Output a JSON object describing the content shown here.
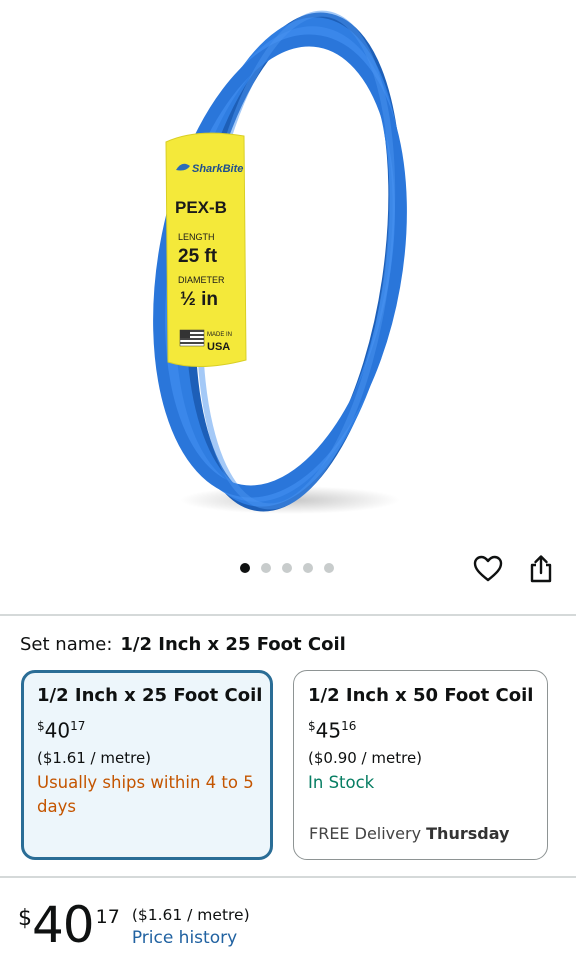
{
  "product_image": {
    "brand": "SharkBite",
    "product_line": "PEX-B",
    "length_label": "LENGTH",
    "length_value": "25 ft",
    "diameter_label": "DIAMETER",
    "diameter_value": "½ in",
    "made_in": "MADE IN",
    "country": "USA",
    "tube_color": "#2f7de1",
    "label_color": "#f4e93a"
  },
  "gallery": {
    "image_count": 5,
    "active_index": 0
  },
  "actions": {
    "wishlist_icon": "heart-icon",
    "share_icon": "share-icon"
  },
  "set_name": {
    "label": "Set name:",
    "value": "1/2 Inch x 25 Foot Coil"
  },
  "options": [
    {
      "title": "1/2 Inch x 25 Foot Coil",
      "currency": "$",
      "price_whole": "40",
      "price_cents": "17",
      "unit_price": "($1.61 / metre)",
      "availability": "Usually ships within 4 to 5 days",
      "availability_color": "#c45500",
      "selected": true
    },
    {
      "title": "1/2 Inch x 50 Foot Coil",
      "currency": "$",
      "price_whole": "45",
      "price_cents": "16",
      "unit_price": "($0.90 / metre)",
      "availability": "In Stock",
      "availability_color": "#067d62",
      "delivery_prefix": "FREE Delivery",
      "delivery_day": "Thursday",
      "selected": false
    }
  ],
  "price": {
    "currency": "$",
    "whole": "40",
    "cents": "17",
    "unit_price": "($1.61 / metre)",
    "history_link": "Price history"
  },
  "colors": {
    "accent_border": "#2a6d96",
    "link": "#2162a1",
    "selected_bg": "#edf6fb"
  }
}
